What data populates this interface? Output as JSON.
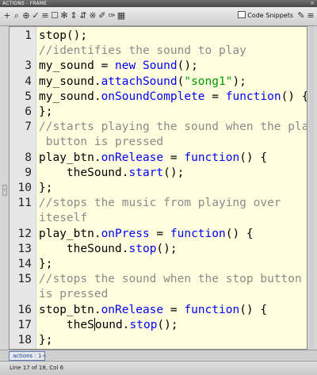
{
  "window": {
    "title": "ACTIONS - FRAME",
    "close_glyph": "×"
  },
  "toolbar": {
    "icons": [
      {
        "name": "add-action-icon",
        "glyph": "+"
      },
      {
        "name": "find-icon",
        "glyph": "⌕"
      },
      {
        "name": "target-icon",
        "glyph": "⊕"
      },
      {
        "name": "check-syntax-icon",
        "glyph": "✓"
      },
      {
        "name": "auto-format-icon",
        "glyph": "≡"
      },
      {
        "name": "code-hint-icon",
        "glyph": "☐"
      },
      {
        "name": "debug-options-icon",
        "glyph": "✻"
      },
      {
        "name": "collapse-icon",
        "glyph": "⇕"
      },
      {
        "name": "collapse-selection-icon",
        "glyph": "⇵"
      },
      {
        "name": "expand-all-icon",
        "glyph": "※"
      },
      {
        "name": "comment-icon",
        "glyph": "✐"
      },
      {
        "name": "uncomment-icon",
        "glyph": "✑"
      },
      {
        "name": "help-icon",
        "glyph": "▦"
      }
    ],
    "snippets_label": "Code Snippets",
    "wand_glyph": "✎",
    "menu_glyph": "≡"
  },
  "code_lines": [
    {
      "n": "1",
      "parts": [
        [
          "p",
          "stop();"
        ]
      ]
    },
    {
      "n": "",
      "parts": [
        [
          "c",
          "//identifies the sound to play"
        ]
      ]
    },
    {
      "n": "3",
      "parts": [
        [
          "p",
          "my_sound = "
        ],
        [
          "k",
          "new"
        ],
        [
          "p",
          " "
        ],
        [
          "k",
          "Sound"
        ],
        [
          "p",
          "();"
        ]
      ]
    },
    {
      "n": "4",
      "parts": [
        [
          "p",
          "my_sound."
        ],
        [
          "k",
          "attachSound"
        ],
        [
          "p",
          "("
        ],
        [
          "s",
          "\"song1\""
        ],
        [
          "p",
          ");"
        ]
      ]
    },
    {
      "n": "5",
      "parts": [
        [
          "p",
          "my_sound."
        ],
        [
          "k",
          "onSoundComplete"
        ],
        [
          "p",
          " = "
        ],
        [
          "k",
          "function"
        ],
        [
          "p",
          "() {"
        ]
      ]
    },
    {
      "n": "6",
      "parts": [
        [
          "p",
          "};"
        ]
      ]
    },
    {
      "n": "7",
      "parts": [
        [
          "c",
          "//starts playing the sound when the play"
        ]
      ]
    },
    {
      "n": "",
      "parts": [
        [
          "c",
          " button is pressed"
        ]
      ]
    },
    {
      "n": "8",
      "parts": [
        [
          "p",
          "play_btn."
        ],
        [
          "k",
          "onRelease"
        ],
        [
          "p",
          " = "
        ],
        [
          "k",
          "function"
        ],
        [
          "p",
          "() {"
        ]
      ]
    },
    {
      "n": "9",
      "parts": [
        [
          "p",
          "    theSound."
        ],
        [
          "k",
          "start"
        ],
        [
          "p",
          "();"
        ]
      ]
    },
    {
      "n": "10",
      "parts": [
        [
          "p",
          "};"
        ]
      ]
    },
    {
      "n": "11",
      "parts": [
        [
          "c",
          "//stops the music from playing over"
        ]
      ]
    },
    {
      "n": "",
      "parts": [
        [
          "c",
          "iteself"
        ]
      ]
    },
    {
      "n": "12",
      "parts": [
        [
          "p",
          "play_btn."
        ],
        [
          "k",
          "onPress"
        ],
        [
          "p",
          " = "
        ],
        [
          "k",
          "function"
        ],
        [
          "p",
          "() {"
        ]
      ]
    },
    {
      "n": "13",
      "parts": [
        [
          "p",
          "    theSound."
        ],
        [
          "k",
          "stop"
        ],
        [
          "p",
          "();"
        ]
      ]
    },
    {
      "n": "14",
      "parts": [
        [
          "p",
          "};"
        ]
      ]
    },
    {
      "n": "15",
      "parts": [
        [
          "c",
          "//stops the sound when the stop button"
        ]
      ]
    },
    {
      "n": "",
      "parts": [
        [
          "c",
          "is pressed"
        ]
      ]
    },
    {
      "n": "16",
      "parts": [
        [
          "p",
          "stop_btn."
        ],
        [
          "k",
          "onRelease"
        ],
        [
          "p",
          " = "
        ],
        [
          "k",
          "function"
        ],
        [
          "p",
          "() {"
        ]
      ]
    },
    {
      "n": "17",
      "parts": [
        [
          "p",
          "    theS"
        ],
        [
          "caret",
          ""
        ],
        [
          "p",
          "ound."
        ],
        [
          "k",
          "stop"
        ],
        [
          "p",
          "();"
        ]
      ]
    },
    {
      "n": "18",
      "parts": [
        [
          "p",
          "};"
        ]
      ]
    }
  ],
  "tabs": {
    "active": "actions : 1",
    "pin_glyph": "⇥"
  },
  "status": {
    "text": "Line 17 of 18, Col 6"
  },
  "side_tab_glyph": "›"
}
